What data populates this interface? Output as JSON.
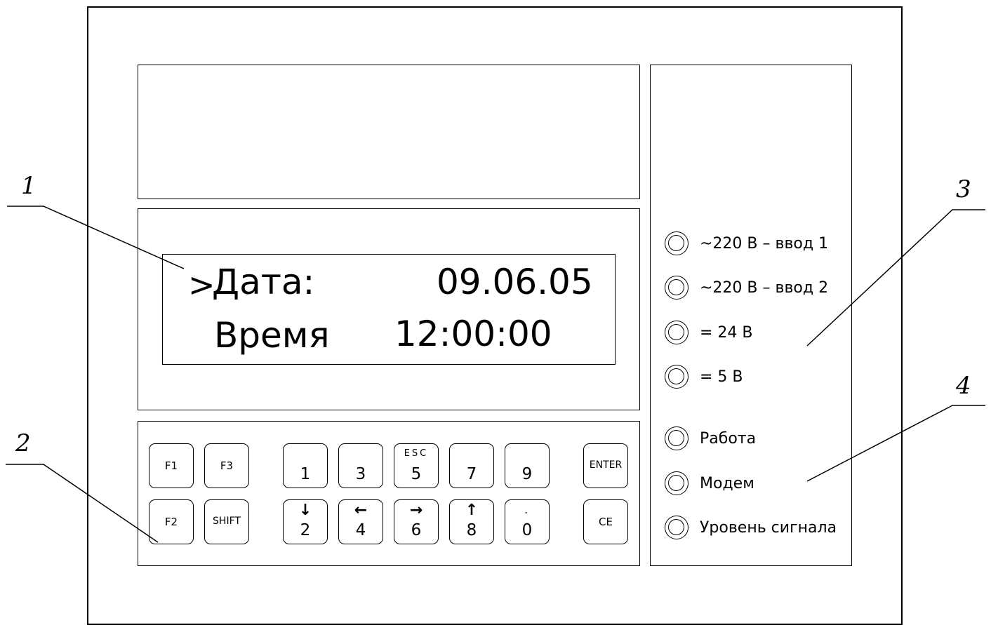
{
  "display": {
    "cursor": ">",
    "row1_label": "Дата:",
    "row1_value": "09.06.05",
    "row2_label": "Время",
    "row2_value": "12:00:00"
  },
  "keypad": {
    "f1": "F1",
    "f2": "F2",
    "f3": "F3",
    "shift": "SHIFT",
    "k1": "1",
    "k3": "3",
    "k5": "5",
    "k5_sub": "ESC",
    "k7": "7",
    "k9": "9",
    "k2": "2",
    "k2_arrow": "↓",
    "k4": "4",
    "k4_arrow": "←",
    "k6": "6",
    "k6_arrow": "→",
    "k8": "8",
    "k8_arrow": "↑",
    "k0": "0",
    "k0_dot": ".",
    "enter": "ENTER",
    "ce": "CE"
  },
  "indicators": [
    {
      "label": "~220 В – ввод 1"
    },
    {
      "label": "~220 В – ввод 2"
    },
    {
      "label": "= 24 В"
    },
    {
      "label": "= 5 В"
    },
    {
      "label": "Работа"
    },
    {
      "label": "Модем"
    },
    {
      "label": "Уровень сигнала"
    }
  ],
  "callouts": {
    "c1": "1",
    "c2": "2",
    "c3": "3",
    "c4": "4"
  }
}
